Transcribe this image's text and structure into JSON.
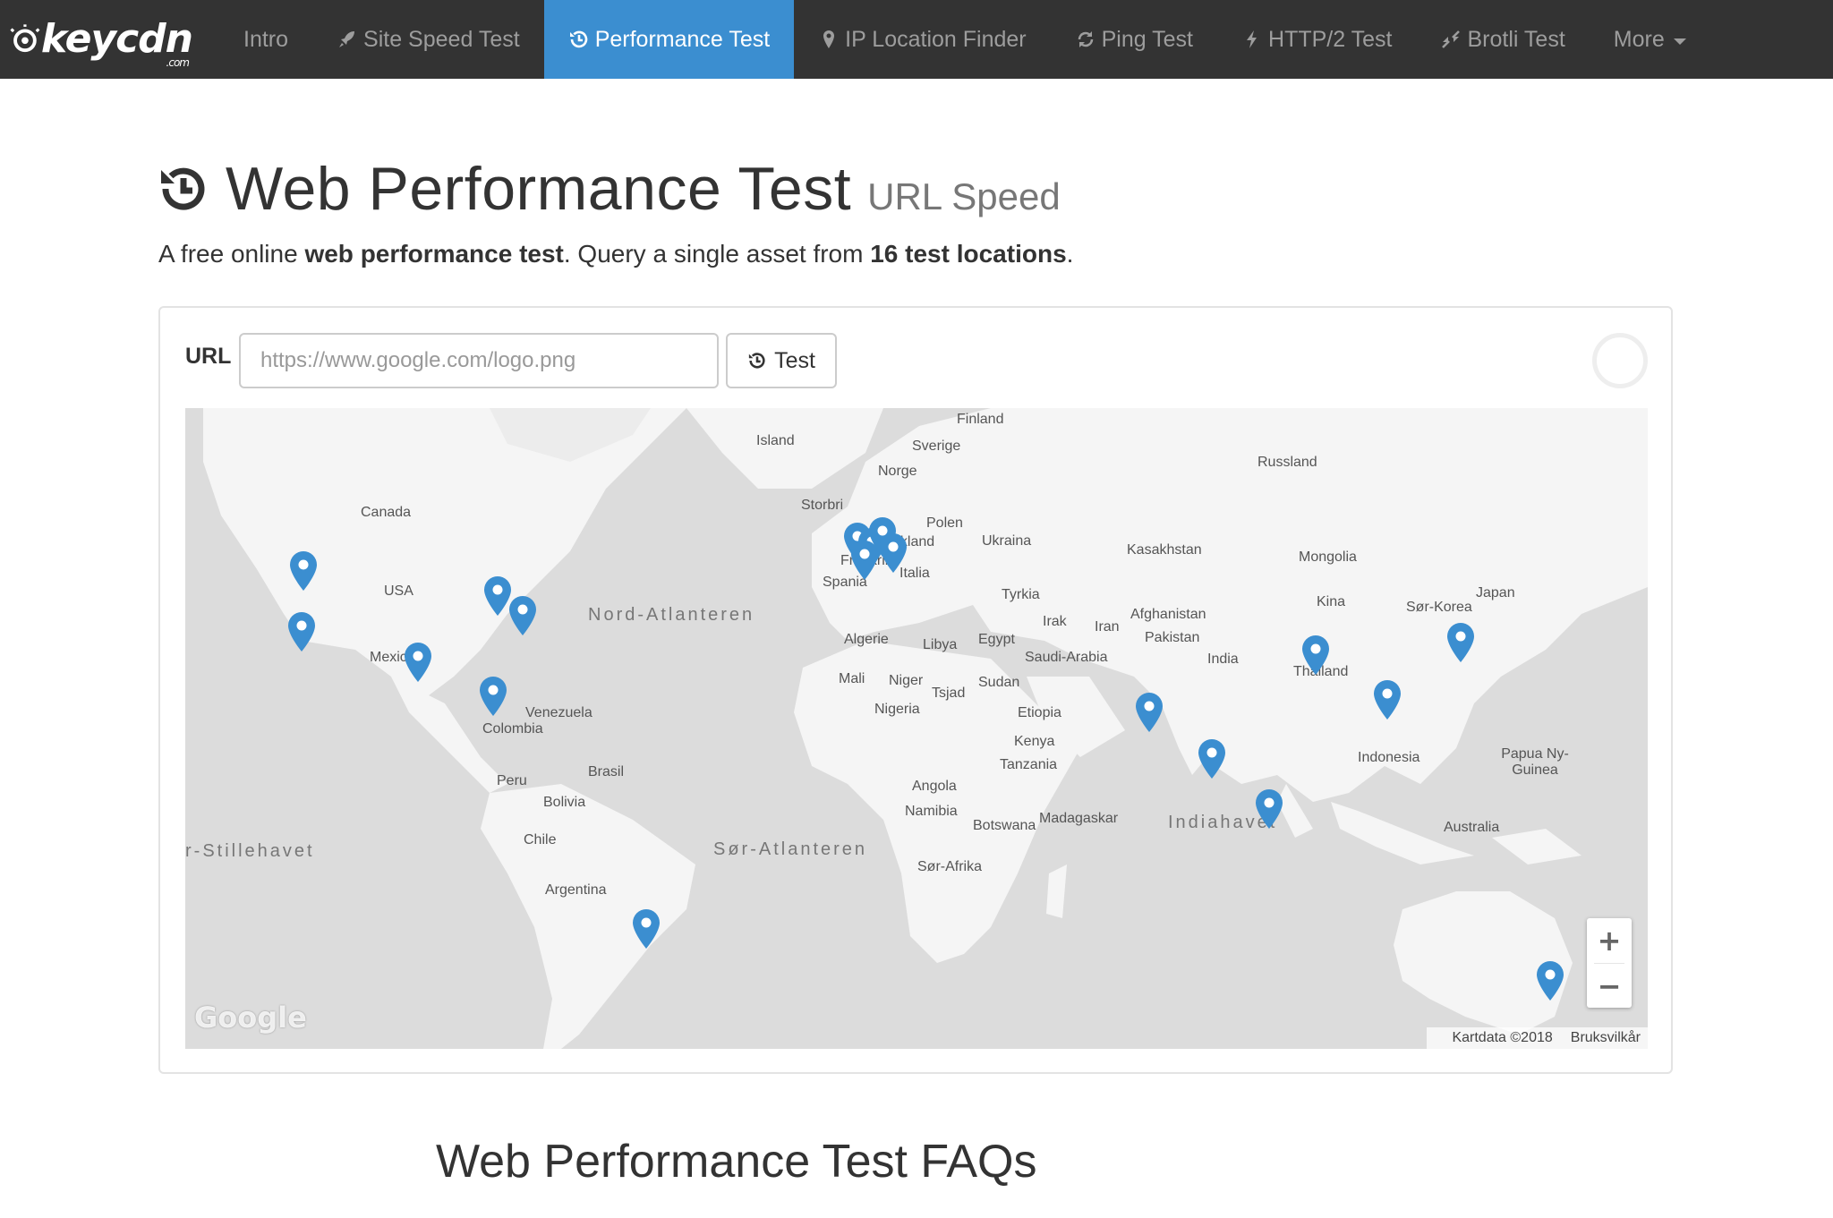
{
  "brand": {
    "name": "keycdn",
    "suffix": ".com"
  },
  "nav": {
    "items": [
      {
        "label": "Intro",
        "icon": "none"
      },
      {
        "label": "Site Speed Test",
        "icon": "rocket-icon"
      },
      {
        "label": "Performance Test",
        "icon": "history-icon",
        "active": true
      },
      {
        "label": "IP Location Finder",
        "icon": "map-marker-icon"
      },
      {
        "label": "Ping Test",
        "icon": "refresh-icon"
      },
      {
        "label": "HTTP/2 Test",
        "icon": "bolt-icon"
      },
      {
        "label": "Brotli Test",
        "icon": "compress-icon"
      },
      {
        "label": "More",
        "icon": "caret-down-icon"
      }
    ]
  },
  "header": {
    "title": "Web Performance Test",
    "subtitle": "URL Speed",
    "lead": {
      "part1": "A free online ",
      "bold1": "web performance test",
      "part2": ". Query a single asset from ",
      "bold2": "16 test locations",
      "part3": "."
    }
  },
  "form": {
    "url_label": "URL",
    "url_placeholder": "https://www.google.com/logo.png",
    "url_value": "",
    "test_button": "Test"
  },
  "map": {
    "labels": [
      "Finland",
      "Island",
      "Sverige",
      "Norge",
      "Russland",
      "Storbritannia",
      "Polen",
      "Canada",
      "Tyskland",
      "Ukraina",
      "Kasakhstan",
      "Mongolia",
      "Frankrike",
      "Italia",
      "Spania",
      "USA",
      "Tyrkia",
      "Kina",
      "Sør-Korea",
      "Japan",
      "Irak",
      "Iran",
      "Afghanistan",
      "Pakistan",
      "Mexico",
      "Algerie",
      "Libya",
      "Egypt",
      "Saudi-Arabia",
      "India",
      "Thailand",
      "Mali",
      "Niger",
      "Tsjad",
      "Sudan",
      "Nigeria",
      "Etiopia",
      "Venezuela",
      "Colombia",
      "Kenya",
      "Tanzania",
      "Indonesia",
      "Papua Ny-Guinea",
      "Brasil",
      "Peru",
      "Angola",
      "Bolivia",
      "Namibia",
      "Botswana",
      "Madagaskar",
      "Australia",
      "Chile",
      "Sør-Afrika",
      "Argentina"
    ],
    "oceans": [
      "Nord-Atlanteren",
      "Sør-Atlanteren",
      "Indiahavet",
      "r-Stillehavet"
    ],
    "marker_count": 19,
    "accent_color": "#3b8ed0",
    "zoom_in": "+",
    "zoom_out": "−",
    "attribution": "Google",
    "map_data": "Kartdata ©2018",
    "terms": "Bruksvilkår"
  },
  "faq": {
    "heading": "Web Performance Test FAQs"
  }
}
